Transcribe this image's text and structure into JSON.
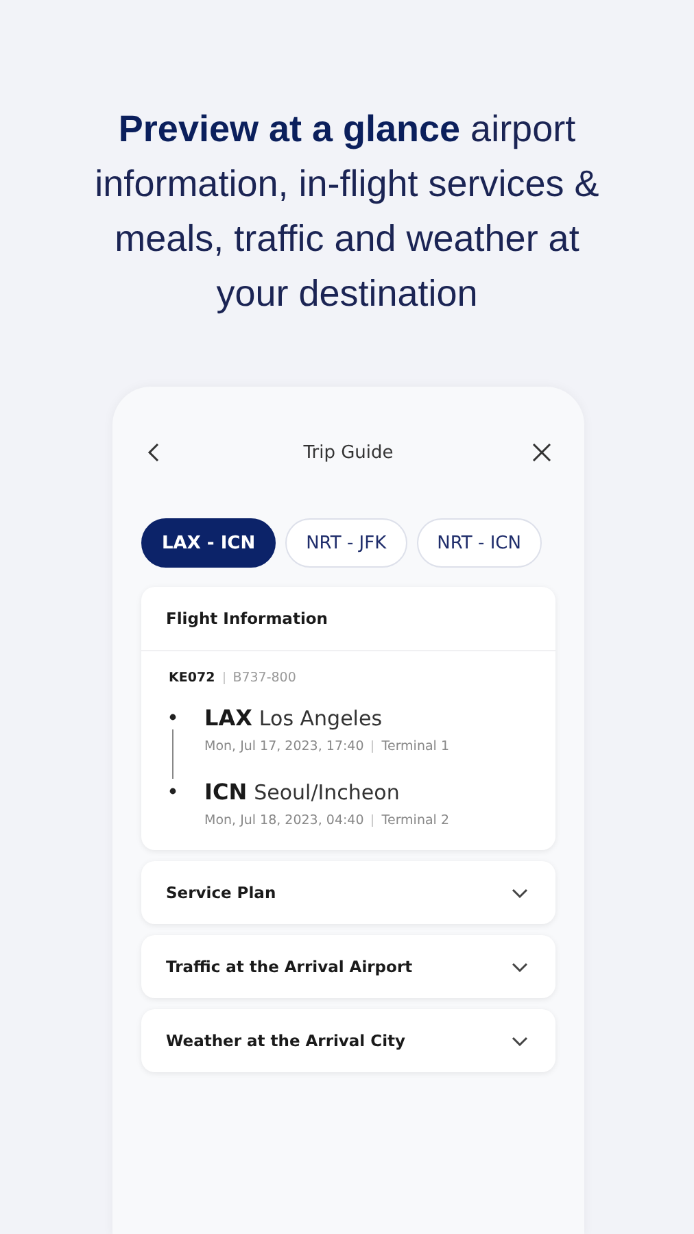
{
  "headline": "**Preview at a glance** airport information, in-flight services & meals, traffic and weather at your destination",
  "screen": {
    "title": "Trip Guide",
    "tabs": [
      {
        "label": "LAX - ICN",
        "selected": true
      },
      {
        "label": "NRT - JFK",
        "selected": false
      },
      {
        "label": "NRT - ICN",
        "selected": false
      }
    ],
    "sections": [
      {
        "title": "Flight Information",
        "expanded": true,
        "flight": {
          "number": "KE072",
          "aircraft": "B737-800",
          "stops": [
            {
              "code": "LAX",
              "city": "Los Angeles",
              "time": "Mon, Jul 17, 2023, 17:40",
              "terminal": "Terminal 1"
            },
            {
              "code": "ICN",
              "city": "Seoul/Incheon",
              "time": "Mon, Jul 18, 2023, 04:40",
              "terminal": "Terminal 2"
            }
          ]
        }
      },
      {
        "title": "Service Plan",
        "expanded": false
      },
      {
        "title": "Traffic at the Arrival Airport",
        "expanded": false
      },
      {
        "title": "Weather at the Arrival City",
        "expanded": false
      }
    ]
  }
}
